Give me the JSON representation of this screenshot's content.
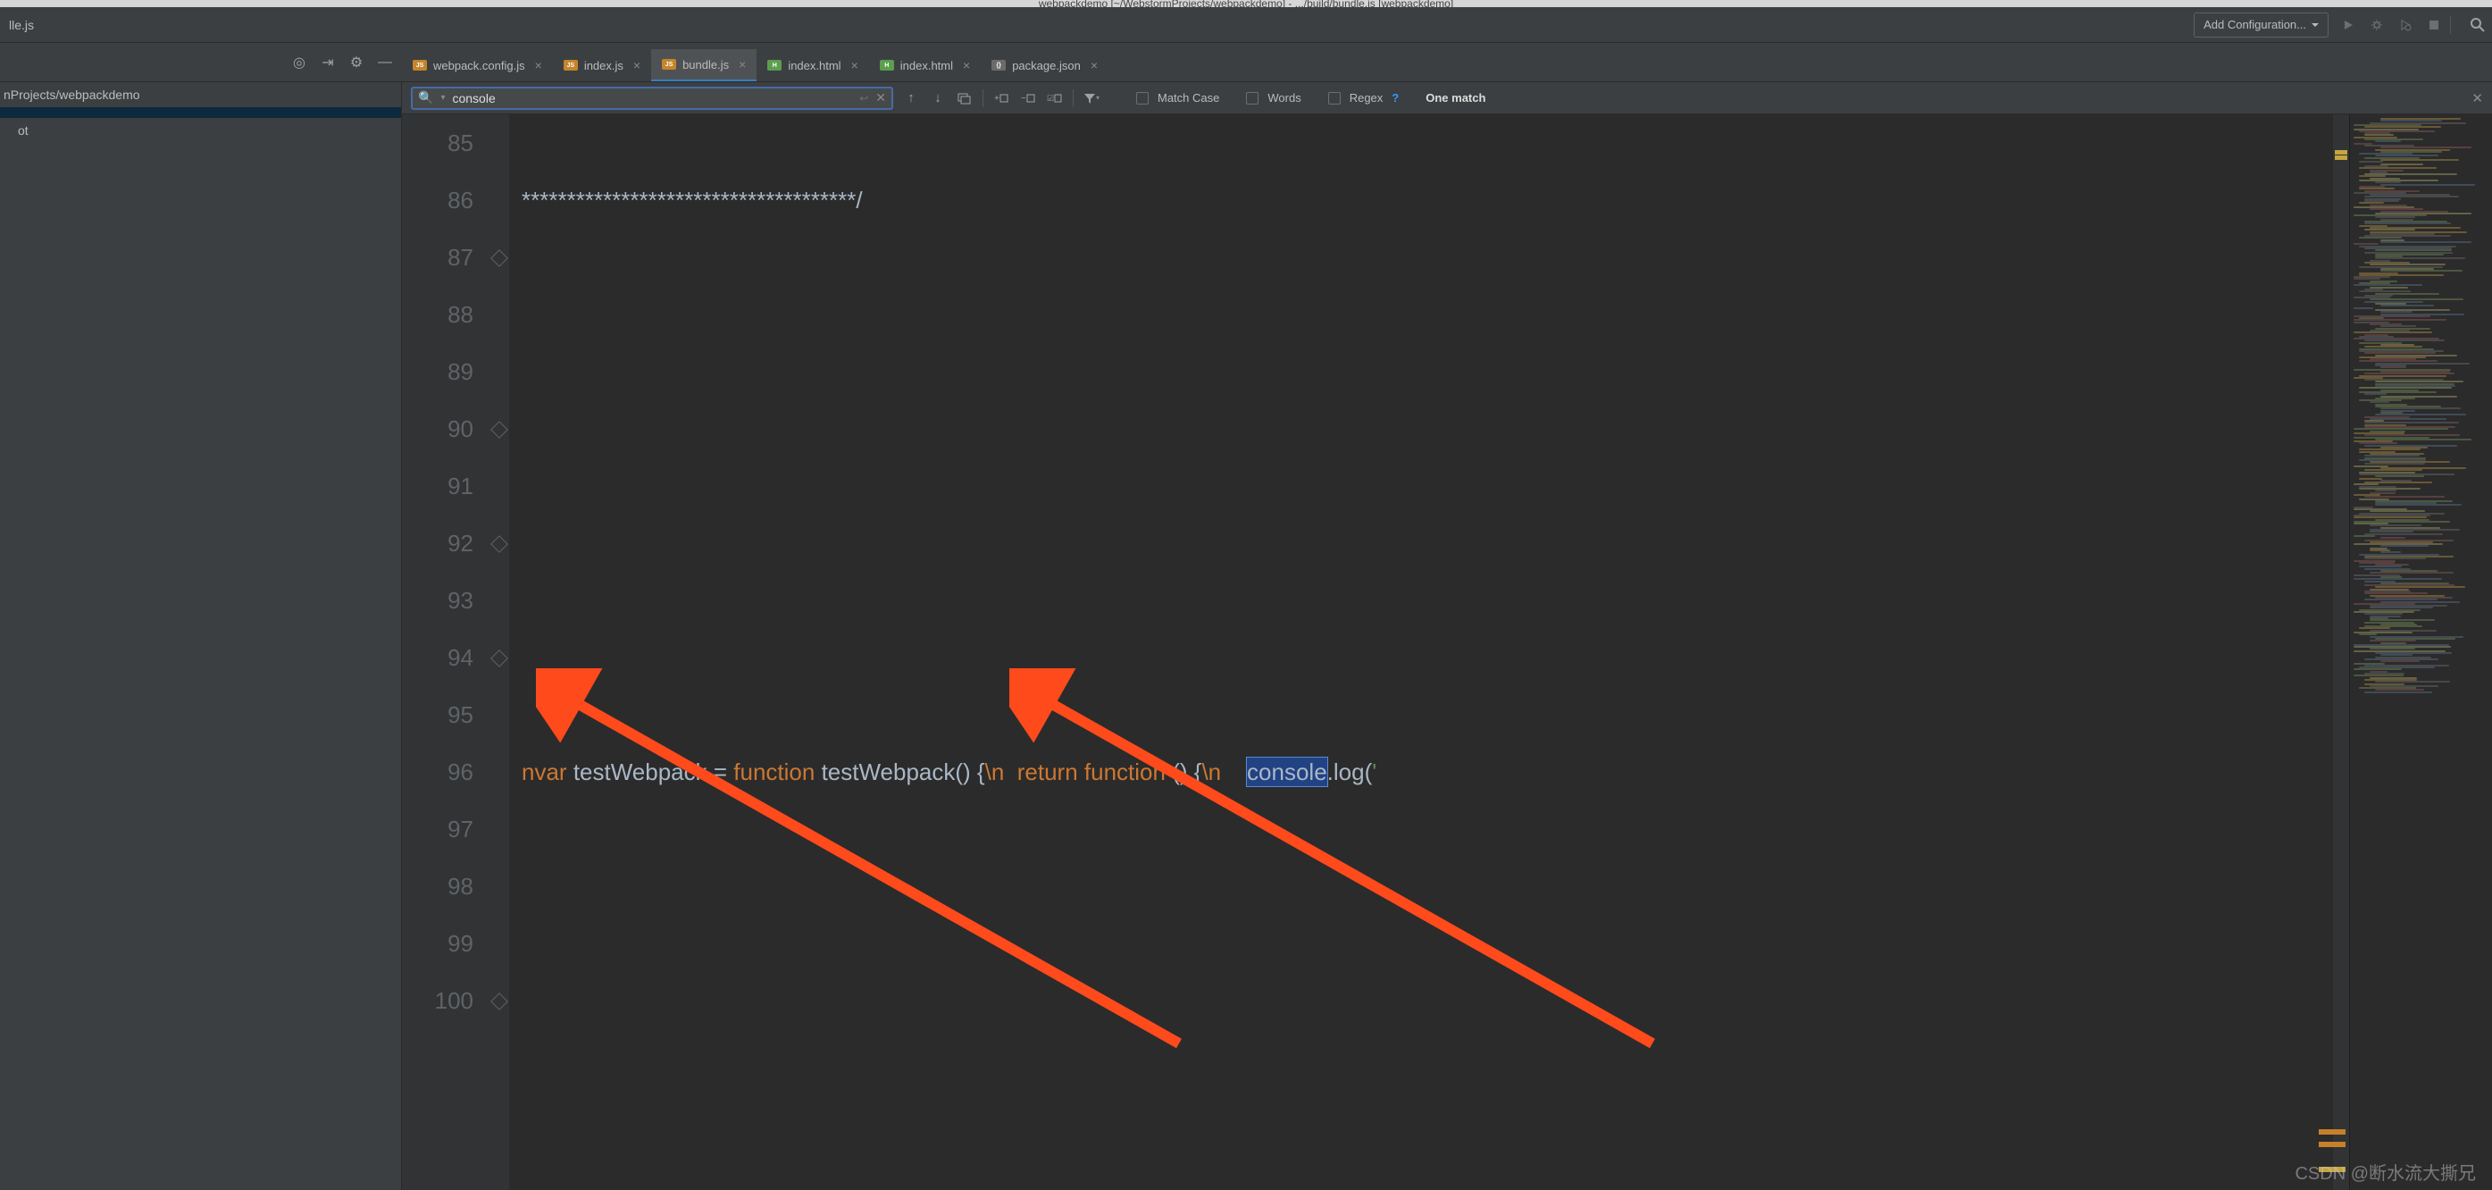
{
  "window_title": "webpackdemo [~/WebstormProjects/webpackdemo] - .../build/bundle.js [webpackdemo]",
  "breadcrumb_file": "lle.js",
  "toolbar": {
    "config_label": "Add Configuration..."
  },
  "sidebar": {
    "path": "nProjects/webpackdemo",
    "items": [
      "",
      "ot"
    ]
  },
  "tabs": [
    {
      "type": "js",
      "label": "webpack.config.js",
      "active": false
    },
    {
      "type": "js",
      "label": "index.js",
      "active": false
    },
    {
      "type": "js",
      "label": "bundle.js",
      "active": true
    },
    {
      "type": "html",
      "label": "index.html",
      "active": false
    },
    {
      "type": "html",
      "label": "index.html",
      "active": false
    },
    {
      "type": "json",
      "label": "package.json",
      "active": false
    }
  ],
  "find": {
    "query": "console",
    "match_case": "Match Case",
    "words": "Words",
    "regex": "Regex",
    "matches": "One match"
  },
  "editor": {
    "lines": [
      {
        "n": 85,
        "html": ""
      },
      {
        "n": 86,
        "html": "*************************************/"
      },
      {
        "n": 87,
        "html": ""
      },
      {
        "n": 88,
        "html": ""
      },
      {
        "n": 89,
        "html": ""
      },
      {
        "n": 90,
        "html": ""
      },
      {
        "n": 91,
        "html": ""
      },
      {
        "n": 92,
        "html": ""
      },
      {
        "n": 93,
        "html": ""
      },
      {
        "n": 94,
        "html": ""
      },
      {
        "n": 95,
        "html": ""
      },
      {
        "n": 96,
        "html": "<span class='c-esc'>n</span><span class='c-kw'>var</span> testWebpack = <span class='c-kw'>function</span> testWebpack() {<span class='c-esc'>\\n</span>  <span class='c-kw'>return</span> <span class='c-kw'>function</span> () {<span class='c-esc'>\\n</span>    <span class='c-hl'>console</span>.log(<span style='color:#6a8759'>'</span>"
      },
      {
        "n": 97,
        "html": ""
      },
      {
        "n": 98,
        "html": ""
      },
      {
        "n": 99,
        "html": ""
      },
      {
        "n": 100,
        "html": ""
      }
    ]
  },
  "watermark": "CSDN @断水流大撕兄"
}
